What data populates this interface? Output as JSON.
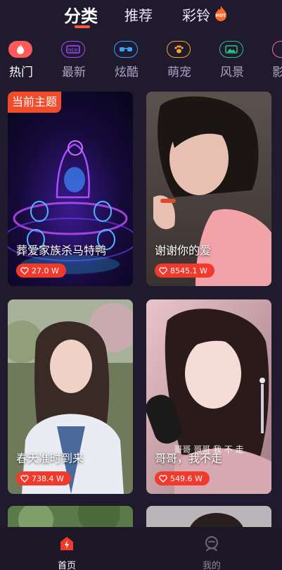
{
  "top_tabs": [
    {
      "label": "分类",
      "active": true
    },
    {
      "label": "推荐",
      "active": false
    },
    {
      "label": "彩铃",
      "active": false,
      "badge_icon": "hot-flame-icon"
    }
  ],
  "categories": [
    {
      "label": "热门",
      "icon": "fire-icon",
      "color": "#ff5a5a",
      "active": true
    },
    {
      "label": "最新",
      "icon": "new-icon",
      "color": "#a34cff",
      "active": false
    },
    {
      "label": "炫酷",
      "icon": "sunglasses-icon",
      "color": "#3aa0ff",
      "active": false
    },
    {
      "label": "萌宠",
      "icon": "paw-icon",
      "color": "#ffa41b",
      "active": false
    },
    {
      "label": "风景",
      "icon": "landscape-icon",
      "color": "#2bc48a",
      "active": false
    },
    {
      "label": "影",
      "icon": "video-icon",
      "color": "#ff6aa0",
      "active": false
    }
  ],
  "cards": [
    {
      "title": "葬爱家族杀马特鸭",
      "likes": "27.0 W",
      "badge": "当前主题"
    },
    {
      "title": "谢谢你的爱",
      "likes": "8545.1 W"
    },
    {
      "title": "春天准时到来",
      "likes": "738.4 W"
    },
    {
      "title": "哥哥，我不走",
      "likes": "549.6 W",
      "overlay": "哥哥 哥哥 我 不 走"
    }
  ],
  "bottom_nav": [
    {
      "label": "首页",
      "icon": "home-flash-icon",
      "active": true
    },
    {
      "label": "我的",
      "icon": "profile-icon",
      "active": false
    }
  ],
  "colors": {
    "accent": "#f23a2c",
    "background": "#1f1a2e"
  }
}
